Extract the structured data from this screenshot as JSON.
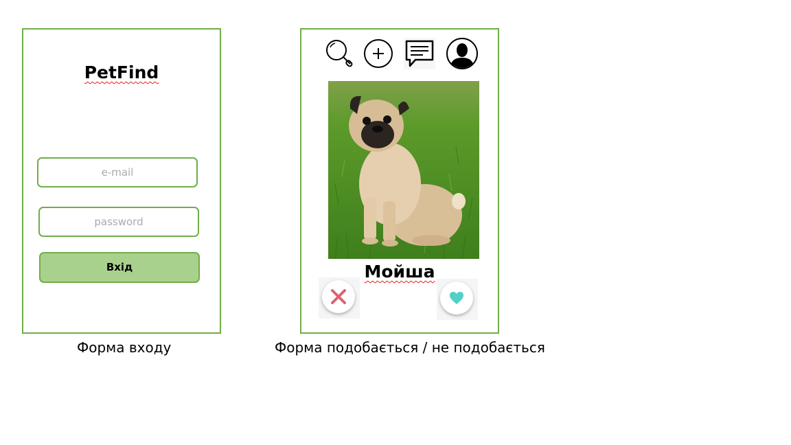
{
  "login": {
    "app_title": "PetFind",
    "email_placeholder": "e-mail",
    "password_placeholder": "password",
    "login_button": "Вхід",
    "caption": "Форма входу"
  },
  "swipe": {
    "nav_icons": [
      "search-icon",
      "add-icon",
      "chat-icon",
      "profile-icon"
    ],
    "pet_name": "Мойша",
    "caption": "Форма подобається / не подобається"
  },
  "colors": {
    "frame_border": "#70ad47",
    "button_fill": "#a9d18e",
    "dislike": "#e06070",
    "like": "#4fd1c5"
  }
}
